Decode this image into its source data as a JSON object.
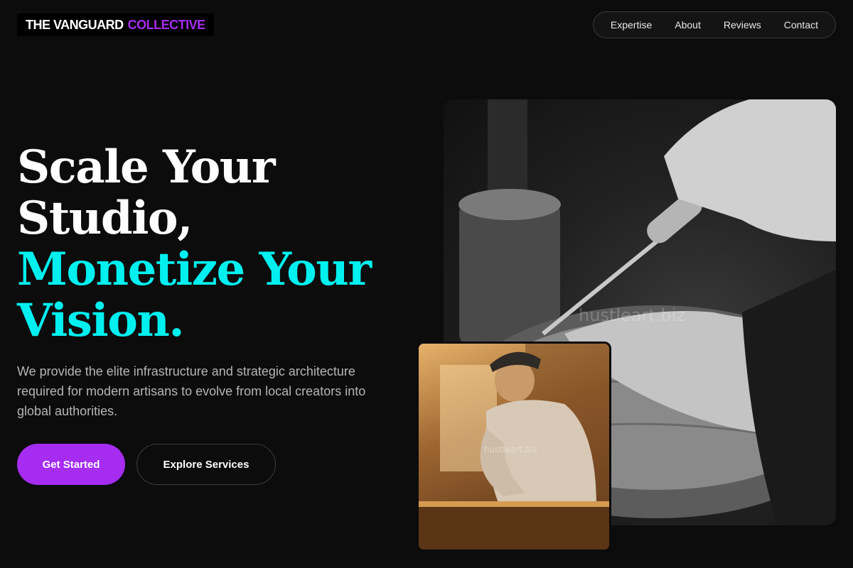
{
  "header": {
    "logo_main": "THE VANGUARD",
    "logo_accent": "COLLECTIVE",
    "nav": [
      {
        "label": "Expertise"
      },
      {
        "label": "About"
      },
      {
        "label": "Reviews"
      },
      {
        "label": "Contact"
      }
    ]
  },
  "hero": {
    "title_line1": "Scale Your",
    "title_line2": "Studio,",
    "title_line3": "Monetize Your",
    "title_line4": "Vision.",
    "subtitle": "We provide the elite infrastructure and strategic architecture required for modern artisans to evolve from local creators into global authorities.",
    "primary_button": "Get Started",
    "secondary_button": "Explore Services"
  },
  "images": {
    "main_watermark": "hustleart.biz",
    "small_watermark": "hustleart.biz"
  },
  "colors": {
    "background": "#0c0c0c",
    "accent_purple": "#a52cf0",
    "accent_cyan": "#00f0f0"
  }
}
